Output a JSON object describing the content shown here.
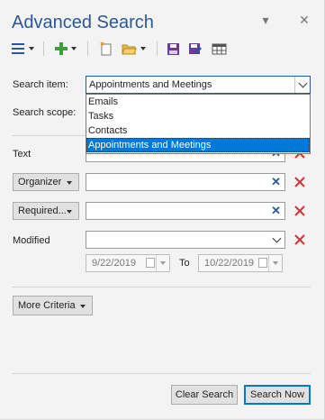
{
  "pane": {
    "title": "Advanced Search",
    "pin_icon": "pin-icon",
    "close_icon": "close-icon"
  },
  "toolbar": {
    "icons": [
      "list-view-icon",
      "add-icon",
      "new-search-icon",
      "open-folder-icon",
      "save-icon",
      "save-as-icon",
      "results-grid-icon"
    ]
  },
  "search_item": {
    "label": "Search item:",
    "value": "Appointments and Meetings",
    "options": [
      "Emails",
      "Tasks",
      "Contacts",
      "Appointments and Meetings"
    ],
    "selected_index": 3
  },
  "search_scope": {
    "label": "Search scope:"
  },
  "criteria": {
    "text_label": "Text",
    "organizer_button": "Organizer",
    "required_button": "Required...",
    "modified_label": "Modified",
    "date_from": "9/22/2019",
    "date_to_label": "To",
    "date_to": "10/22/2019"
  },
  "more_criteria_button": "More Criteria",
  "buttons": {
    "clear": "Clear Search",
    "search": "Search Now"
  },
  "colors": {
    "title": "#2b579a",
    "accent": "#0078d7",
    "remove": "#d13438",
    "add": "#3a9e3a"
  }
}
